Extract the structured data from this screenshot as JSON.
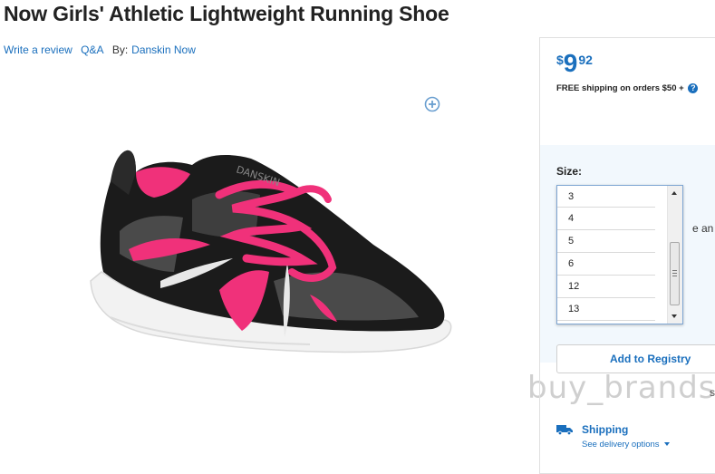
{
  "product": {
    "title": "Now Girls' Athletic Lightweight Running Shoe",
    "write_review": "Write a review",
    "qa": "Q&A",
    "by_label": "By:",
    "brand": "Danskin Now"
  },
  "price": {
    "currency": "$",
    "dollars": "9",
    "cents": "92",
    "shipping_note": "FREE shipping on orders $50 +"
  },
  "size": {
    "label": "Size:",
    "options": [
      "3",
      "4",
      "5",
      "6",
      "12",
      "13"
    ],
    "partial_hidden_text": "e an o"
  },
  "registry": {
    "button_label": "Add to Registry"
  },
  "shipping": {
    "label": "Shipping",
    "link": "See delivery options"
  },
  "watermark": {
    "text": "buy_brands",
    "tail": "s"
  },
  "colors": {
    "accent": "#1a6fbd",
    "shoe_black": "#1b1b1b",
    "shoe_pink": "#f0317a",
    "shoe_grey": "#4a4a4a",
    "sole_white": "#f4f4f4"
  },
  "icons": {
    "zoom": "plus-circle-icon",
    "help": "question-circle-icon",
    "shipping": "truck-icon"
  }
}
